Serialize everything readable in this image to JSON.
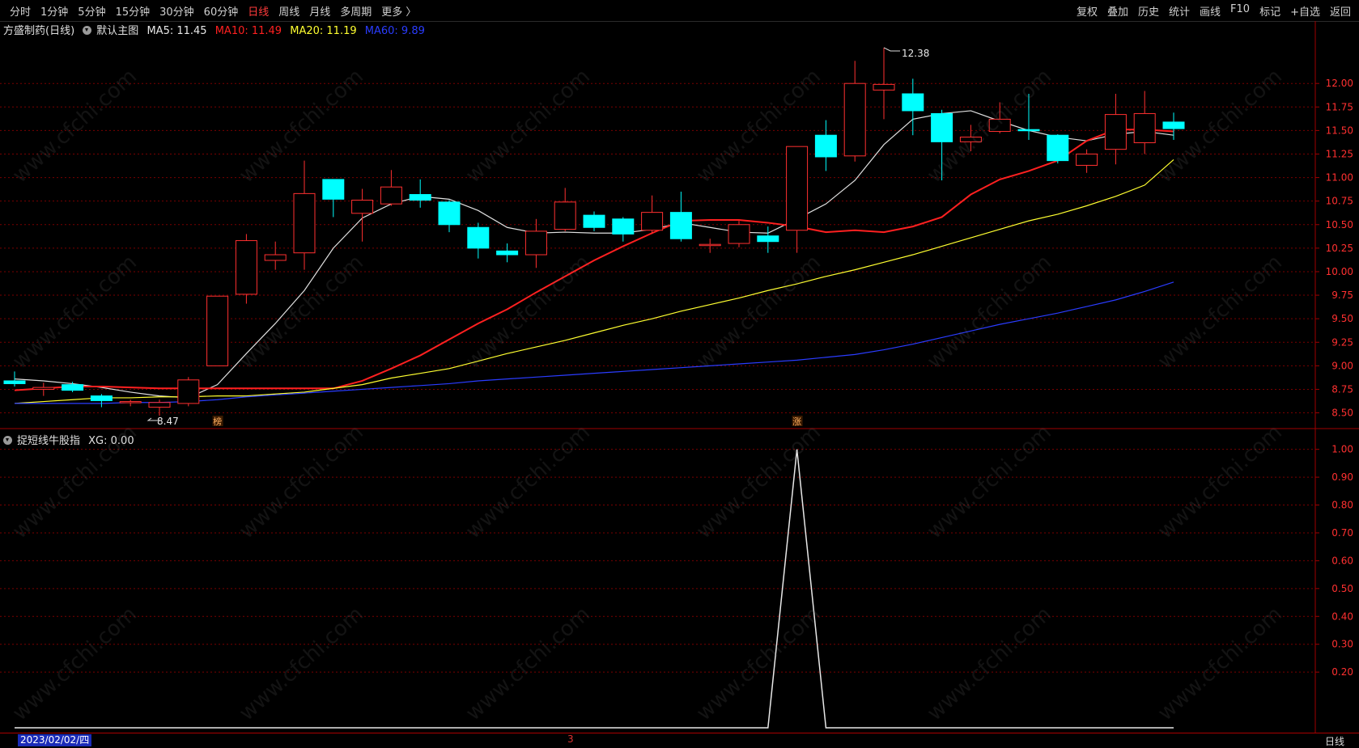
{
  "toolbar": {
    "periods": [
      "分时",
      "1分钟",
      "5分钟",
      "15分钟",
      "30分钟",
      "60分钟",
      "日线",
      "周线",
      "月线",
      "多周期",
      "更多 〉"
    ],
    "active_period": "日线",
    "right_buttons": [
      "复权",
      "叠加",
      "历史",
      "统计",
      "画线",
      "F10",
      "标记",
      "+自选",
      "返回"
    ]
  },
  "main_panel": {
    "stock": "方盛制药(日线)",
    "template": "默认主图",
    "ma": [
      {
        "label": "MA5: 11.45",
        "color": "#e8e8e8"
      },
      {
        "label": "MA10: 11.49",
        "color": "#ff2020"
      },
      {
        "label": "MA20: 11.19",
        "color": "#ffff30"
      },
      {
        "label": "MA60: 9.89",
        "color": "#2a3cff"
      }
    ],
    "max_label": "12.38",
    "min_label": "8.47",
    "marker1": "榜",
    "marker2": "涨"
  },
  "sub_panel": {
    "indicator": "捉短线牛股指",
    "value_label": "XG: 0.00"
  },
  "footer": {
    "date": "2023/02/02/四",
    "month_marker": "3",
    "period_label": "日线"
  },
  "watermark": "www.cfchi.com",
  "colors": {
    "up": "#ff3030",
    "down": "#00ffff",
    "grid": "#7a0000",
    "axis": "#a00000"
  },
  "chart_data": [
    {
      "type": "candlestick",
      "title": "方盛制药(日线)",
      "ylim": [
        8.35,
        12.5
      ],
      "y_ticks": [
        8.5,
        8.75,
        9.0,
        9.25,
        9.5,
        9.75,
        10.0,
        10.25,
        10.5,
        10.75,
        11.0,
        11.25,
        11.5,
        11.75,
        12.0
      ],
      "candles": [
        {
          "o": 8.84,
          "c": 8.81,
          "h": 8.94,
          "l": 8.78
        },
        {
          "o": 8.75,
          "c": 8.77,
          "h": 8.82,
          "l": 8.68
        },
        {
          "o": 8.8,
          "c": 8.74,
          "h": 8.83,
          "l": 8.72
        },
        {
          "o": 8.68,
          "c": 8.63,
          "h": 8.7,
          "l": 8.56
        },
        {
          "o": 8.62,
          "c": 8.62,
          "h": 8.64,
          "l": 8.57
        },
        {
          "o": 8.56,
          "c": 8.61,
          "h": 8.64,
          "l": 8.47
        },
        {
          "o": 8.6,
          "c": 8.85,
          "h": 8.88,
          "l": 8.57
        },
        {
          "o": 9.0,
          "c": 9.74,
          "h": 9.74,
          "l": 9.0
        },
        {
          "o": 9.76,
          "c": 10.33,
          "h": 10.4,
          "l": 9.66
        },
        {
          "o": 10.12,
          "c": 10.18,
          "h": 10.32,
          "l": 10.02
        },
        {
          "o": 10.2,
          "c": 10.83,
          "h": 11.18,
          "l": 10.02
        },
        {
          "o": 10.98,
          "c": 10.77,
          "h": 10.98,
          "l": 10.58
        },
        {
          "o": 10.62,
          "c": 10.76,
          "h": 10.88,
          "l": 10.32
        },
        {
          "o": 10.72,
          "c": 10.9,
          "h": 11.08,
          "l": 10.7
        },
        {
          "o": 10.82,
          "c": 10.76,
          "h": 10.98,
          "l": 10.68
        },
        {
          "o": 10.74,
          "c": 10.5,
          "h": 10.76,
          "l": 10.42
        },
        {
          "o": 10.47,
          "c": 10.25,
          "h": 10.52,
          "l": 10.14
        },
        {
          "o": 10.22,
          "c": 10.18,
          "h": 10.3,
          "l": 10.1
        },
        {
          "o": 10.18,
          "c": 10.43,
          "h": 10.56,
          "l": 10.04
        },
        {
          "o": 10.45,
          "c": 10.74,
          "h": 10.89,
          "l": 10.43
        },
        {
          "o": 10.6,
          "c": 10.47,
          "h": 10.64,
          "l": 10.43
        },
        {
          "o": 10.56,
          "c": 10.4,
          "h": 10.58,
          "l": 10.32
        },
        {
          "o": 10.44,
          "c": 10.63,
          "h": 10.81,
          "l": 10.4
        },
        {
          "o": 10.63,
          "c": 10.35,
          "h": 10.85,
          "l": 10.32
        },
        {
          "o": 10.29,
          "c": 10.29,
          "h": 10.35,
          "l": 10.2
        },
        {
          "o": 10.3,
          "c": 10.5,
          "h": 10.54,
          "l": 10.26
        },
        {
          "o": 10.38,
          "c": 10.32,
          "h": 10.48,
          "l": 10.2
        },
        {
          "o": 10.44,
          "c": 11.33,
          "h": 11.33,
          "l": 10.2
        },
        {
          "o": 11.45,
          "c": 11.22,
          "h": 11.61,
          "l": 11.07
        },
        {
          "o": 11.23,
          "c": 12.0,
          "h": 12.24,
          "l": 11.17
        },
        {
          "o": 11.93,
          "c": 11.99,
          "h": 12.38,
          "l": 11.62
        },
        {
          "o": 11.89,
          "c": 11.71,
          "h": 12.05,
          "l": 11.45
        },
        {
          "o": 11.68,
          "c": 11.38,
          "h": 11.72,
          "l": 10.97
        },
        {
          "o": 11.38,
          "c": 11.43,
          "h": 11.56,
          "l": 11.28
        },
        {
          "o": 11.49,
          "c": 11.62,
          "h": 11.8,
          "l": 11.47
        },
        {
          "o": 11.51,
          "c": 11.5,
          "h": 11.89,
          "l": 11.4
        },
        {
          "o": 11.45,
          "c": 11.18,
          "h": 11.46,
          "l": 11.15
        },
        {
          "o": 11.13,
          "c": 11.25,
          "h": 11.3,
          "l": 11.05
        },
        {
          "o": 11.3,
          "c": 11.67,
          "h": 11.89,
          "l": 11.14
        },
        {
          "o": 11.37,
          "c": 11.68,
          "h": 11.92,
          "l": 11.25
        },
        {
          "o": 11.59,
          "c": 11.52,
          "h": 11.69,
          "l": 11.4
        }
      ],
      "ma_lines": [
        {
          "name": "MA5",
          "color": "#e0e0e0",
          "values": [
            8.86,
            8.84,
            8.81,
            8.77,
            8.72,
            8.68,
            8.66,
            8.8,
            9.13,
            9.45,
            9.8,
            10.25,
            10.57,
            10.72,
            10.8,
            10.77,
            10.65,
            10.47,
            10.41,
            10.42,
            10.41,
            10.41,
            10.45,
            10.52,
            10.47,
            10.42,
            10.41,
            10.56,
            10.72,
            10.97,
            11.35,
            11.62,
            11.68,
            11.71,
            11.6,
            11.5,
            11.43,
            11.39,
            11.46,
            11.49,
            11.45
          ]
        },
        {
          "name": "MA10",
          "color": "#ff2020",
          "values": [
            8.74,
            8.76,
            8.78,
            8.78,
            8.77,
            8.76,
            8.76,
            8.76,
            8.76,
            8.76,
            8.76,
            8.76,
            8.84,
            8.97,
            9.11,
            9.28,
            9.45,
            9.6,
            9.78,
            9.95,
            10.12,
            10.27,
            10.41,
            10.54,
            10.55,
            10.55,
            10.52,
            10.48,
            10.42,
            10.44,
            10.42,
            10.48,
            10.58,
            10.82,
            10.98,
            11.07,
            11.18,
            11.39,
            11.51,
            11.51,
            11.49
          ]
        },
        {
          "name": "MA20",
          "color": "#ffff30",
          "values": [
            8.6,
            8.62,
            8.64,
            8.66,
            8.66,
            8.67,
            8.67,
            8.68,
            8.68,
            8.7,
            8.72,
            8.76,
            8.8,
            8.87,
            8.92,
            8.97,
            9.05,
            9.13,
            9.2,
            9.27,
            9.35,
            9.43,
            9.5,
            9.58,
            9.65,
            9.72,
            9.8,
            9.87,
            9.95,
            10.02,
            10.1,
            10.18,
            10.27,
            10.36,
            10.45,
            10.54,
            10.61,
            10.7,
            10.8,
            10.92,
            11.19
          ]
        },
        {
          "name": "MA60",
          "color": "#2a3cff",
          "values": [
            8.6,
            8.6,
            8.6,
            8.6,
            8.61,
            8.61,
            8.62,
            8.64,
            8.67,
            8.69,
            8.71,
            8.73,
            8.75,
            8.77,
            8.79,
            8.81,
            8.84,
            8.86,
            8.88,
            8.9,
            8.92,
            8.94,
            8.96,
            8.98,
            9.0,
            9.02,
            9.04,
            9.06,
            9.09,
            9.12,
            9.17,
            9.23,
            9.3,
            9.37,
            9.44,
            9.5,
            9.56,
            9.63,
            9.7,
            9.79,
            9.89
          ]
        }
      ]
    },
    {
      "type": "line",
      "title": "捉短线牛股指",
      "ylim": [
        0,
        1.06
      ],
      "y_ticks": [
        0.2,
        0.3,
        0.4,
        0.5,
        0.6,
        0.7,
        0.8,
        0.9,
        1.0
      ],
      "series": [
        {
          "name": "XG",
          "values": [
            0,
            0,
            0,
            0,
            0,
            0,
            0,
            0,
            0,
            0,
            0,
            0,
            0,
            0,
            0,
            0,
            0,
            0,
            0,
            0,
            0,
            0,
            0,
            0,
            0,
            0,
            0,
            1,
            0,
            0,
            0,
            0,
            0,
            0,
            0,
            0,
            0,
            0,
            0,
            0,
            0
          ]
        }
      ]
    }
  ]
}
